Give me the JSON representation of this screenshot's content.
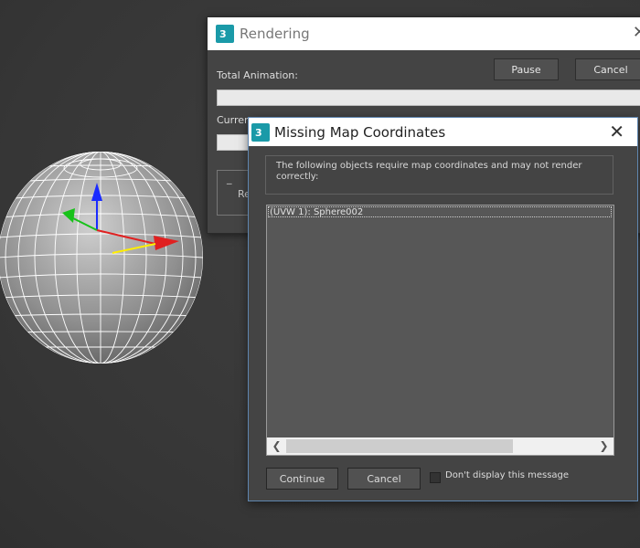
{
  "rendering_window": {
    "title": "Rendering",
    "total_animation_label": "Total Animation:",
    "current_label_partial": "Curren",
    "pause_label": "Pause",
    "cancel_label": "Cancel",
    "partial_text_1": "_",
    "partial_text_2": "Re"
  },
  "dialog": {
    "title": "Missing Map Coordinates",
    "message": "The following objects require map coordinates and may not render correctly:",
    "items": [
      "(UVW 1): Sphere002"
    ],
    "continue_label": "Continue",
    "cancel_label": "Cancel",
    "checkbox_label": "Don't display this message",
    "checkbox_checked": false
  },
  "colors": {
    "viewport_bg": "#3a3a3a",
    "accent_border": "#5f86b0",
    "app_icon": "#1a9aa8"
  },
  "icons": {
    "app": "3ds-max-logo-icon",
    "close": "close-icon",
    "scroll_left": "chevron-left-icon",
    "scroll_right": "chevron-right-icon"
  }
}
